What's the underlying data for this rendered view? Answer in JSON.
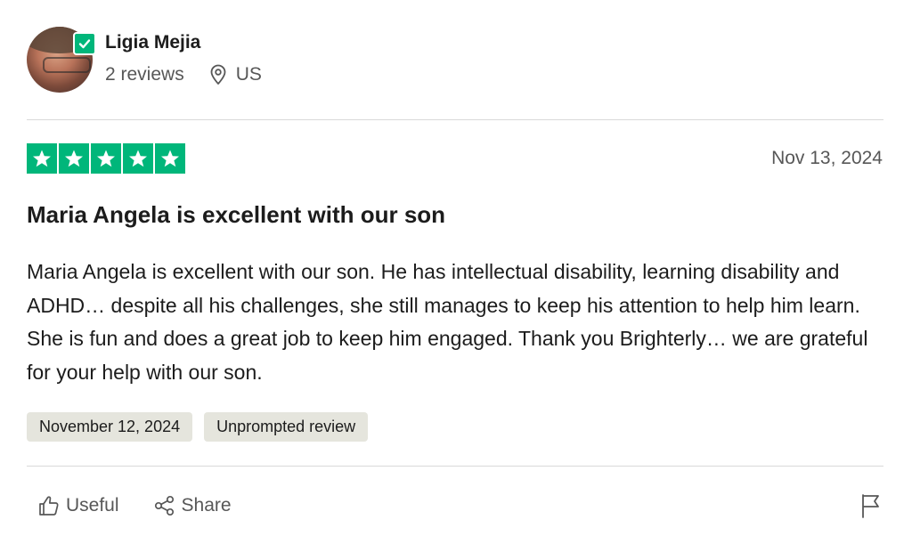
{
  "reviewer": {
    "name": "Ligia Mejia",
    "reviews_count": "2 reviews",
    "country": "US",
    "avatar_icon": "avatar-photo",
    "verified_icon": "check-icon"
  },
  "review": {
    "rating": 5,
    "rating_max": 5,
    "date": "Nov 13, 2024",
    "title": "Maria Angela is excellent with our son",
    "body": "Maria Angela is excellent with our son. He has intellectual disability, learning disability and ADHD… despite all his challenges, she still manages to keep his attention to help him learn. She is fun and does a great job to keep him engaged. Thank you Brighterly… we are grateful for your help with our son.",
    "tags": [
      "November 12, 2024",
      "Unprompted review"
    ]
  },
  "actions": {
    "useful_label": "Useful",
    "share_label": "Share"
  },
  "colors": {
    "star_green": "#00b67a",
    "tag_bg": "#e5e5dd",
    "muted_text": "#575757"
  }
}
